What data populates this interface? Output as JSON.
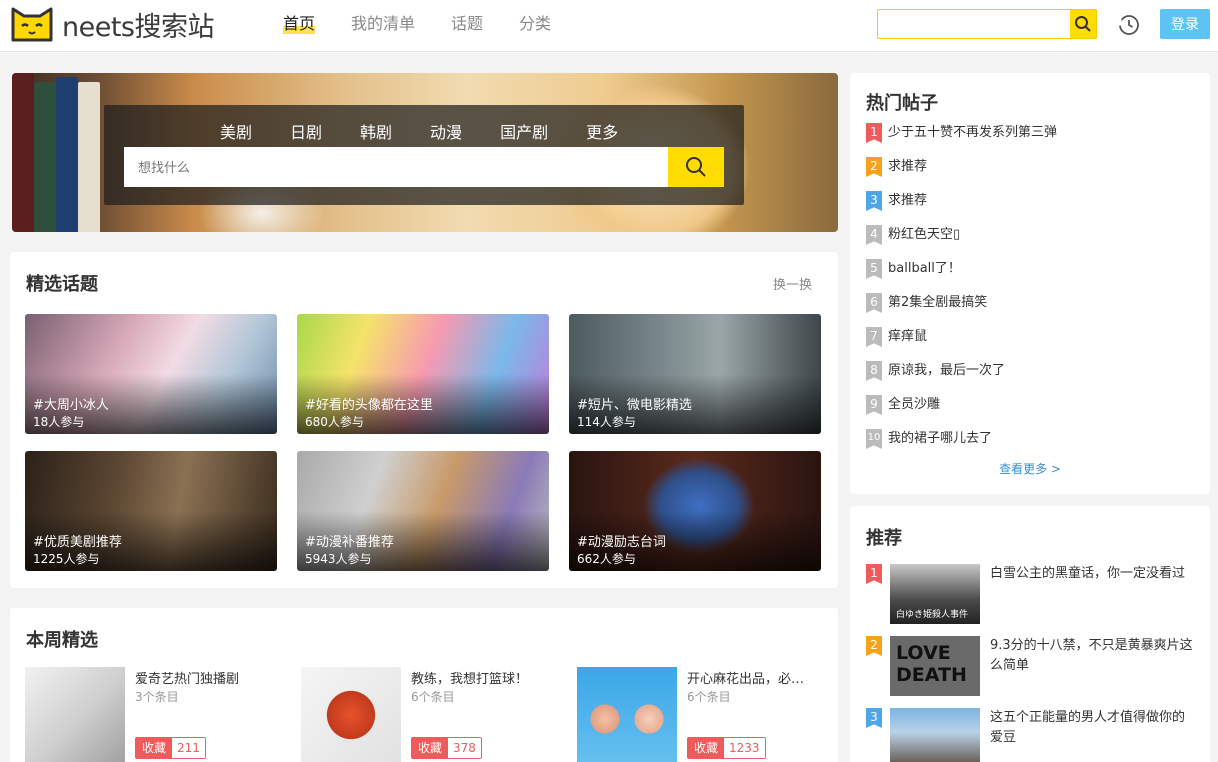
{
  "header": {
    "logo_text": "neets搜索站",
    "nav": [
      {
        "label": "首页",
        "active": true
      },
      {
        "label": "我的清单"
      },
      {
        "label": "话题"
      },
      {
        "label": "分类"
      }
    ],
    "search_value": "",
    "login_label": "登录"
  },
  "banner": {
    "categories": [
      "美剧",
      "日剧",
      "韩剧",
      "动漫",
      "国产剧",
      "更多"
    ],
    "search_placeholder": "想找什么"
  },
  "topics": {
    "title": "精选话题",
    "refresh_label": "换一换",
    "items": [
      {
        "name": "#大周小冰人",
        "count": "18人参与"
      },
      {
        "name": "#好看的头像都在这里",
        "count": "680人参与"
      },
      {
        "name": "#短片、微电影精选",
        "count": "114人参与"
      },
      {
        "name": "#优质美剧推荐",
        "count": "1225人参与"
      },
      {
        "name": "#动漫补番推荐",
        "count": "5943人参与"
      },
      {
        "name": "#动漫励志台词",
        "count": "662人参与"
      }
    ]
  },
  "weekly": {
    "title": "本周精选",
    "items": [
      {
        "title": "爱奇艺热门独播剧",
        "count": "3个条目",
        "fav_label": "收藏",
        "fav_count": "211"
      },
      {
        "title": "教练，我想打篮球！",
        "count": "6个条目",
        "fav_label": "收藏",
        "fav_count": "378"
      },
      {
        "title": "开心麻花出品，必…",
        "count": "6个条目",
        "fav_label": "收藏",
        "fav_count": "1233"
      }
    ]
  },
  "hot": {
    "title": "热门帖子",
    "items": [
      {
        "rank": "1",
        "text": "少于五十赞不再发系列第三弹"
      },
      {
        "rank": "2",
        "text": "求推荐"
      },
      {
        "rank": "3",
        "text": "求推荐"
      },
      {
        "rank": "4",
        "text": "粉红色天空▯"
      },
      {
        "rank": "5",
        "text": "ballball了！"
      },
      {
        "rank": "6",
        "text": "第2集全剧最搞笑"
      },
      {
        "rank": "7",
        "text": "痒痒鼠"
      },
      {
        "rank": "8",
        "text": "原谅我，最后一次了"
      },
      {
        "rank": "9",
        "text": "全员沙雕"
      },
      {
        "rank": "10",
        "text": "我的裙子哪儿去了"
      }
    ],
    "more_label": "查看更多 >"
  },
  "recommend": {
    "title": "推荐",
    "items": [
      {
        "rank": "1",
        "title": "白雪公主的黑童话，你一定没看过",
        "thumb_text": "白ゆき姫殺人事件"
      },
      {
        "rank": "2",
        "title": "9.3分的十八禁，不只是黄暴爽片这么简单",
        "thumb_text": "LOVE DEATH"
      },
      {
        "rank": "3",
        "title": "这五个正能量的男人才值得做你的爱豆",
        "thumb_text": ""
      }
    ]
  },
  "colors": {
    "accent": "#ffdd00",
    "login": "#5dc3f4",
    "rank1": "#ef5a5a",
    "rank2": "#f7a21b",
    "rank3": "#4da6ea",
    "rank_other": "#bbbbbb",
    "fav": "#ef5a5a"
  }
}
